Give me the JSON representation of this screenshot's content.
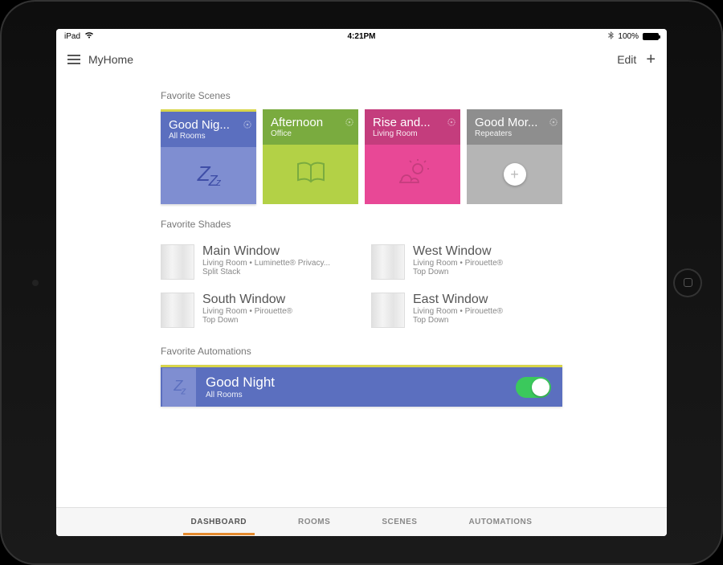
{
  "statusbar": {
    "device": "iPad",
    "time": "4:21PM",
    "battery_pct": "100%"
  },
  "appbar": {
    "title": "MyHome",
    "edit": "Edit"
  },
  "sections": {
    "scenes_title": "Favorite Scenes",
    "shades_title": "Favorite Shades",
    "automations_title": "Favorite Automations"
  },
  "scenes": [
    {
      "name": "Good Nig...",
      "sub": "All Rooms",
      "theme": "blue",
      "icon": "sleep"
    },
    {
      "name": "Afternoon",
      "sub": "Office",
      "theme": "green",
      "icon": "book"
    },
    {
      "name": "Rise and...",
      "sub": "Living Room",
      "theme": "pink",
      "icon": "sunrise"
    },
    {
      "name": "Good Mor...",
      "sub": "Repeaters",
      "theme": "grey",
      "icon": "add"
    }
  ],
  "shades": [
    {
      "title": "Main Window",
      "line1": "Living Room • Luminette® Privacy...",
      "line2": "Split Stack"
    },
    {
      "title": "West Window",
      "line1": "Living Room • Pirouette®",
      "line2": "Top Down"
    },
    {
      "title": "South Window",
      "line1": "Living Room • Pirouette®",
      "line2": "Top Down"
    },
    {
      "title": "East Window",
      "line1": "Living Room • Pirouette®",
      "line2": "Top Down"
    }
  ],
  "automation": {
    "title": "Good Night",
    "sub": "All Rooms",
    "on": true
  },
  "tabs": {
    "dashboard": "DASHBOARD",
    "rooms": "ROOMS",
    "scenes": "SCENES",
    "automations": "AUTOMATIONS"
  }
}
